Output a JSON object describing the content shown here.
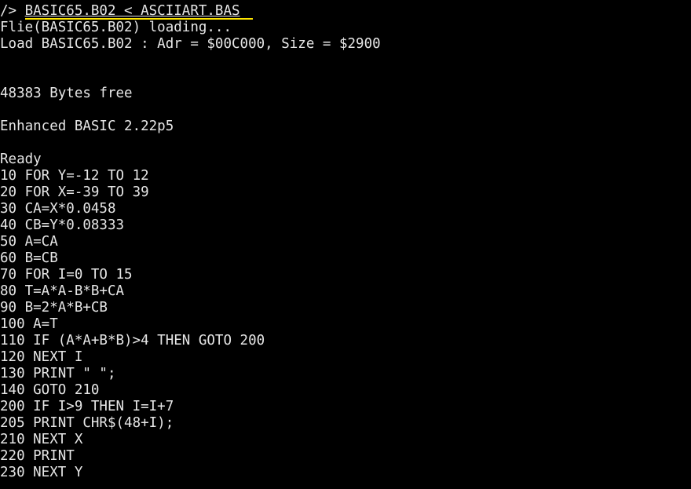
{
  "theme": {
    "background": "#000000",
    "foreground": "#e6e6e6",
    "highlight": "#ffe600"
  },
  "prompt": {
    "symbol": "/> ",
    "command": "BASIC65.B02 < ASCIIART.BAS"
  },
  "output": {
    "loading": "Flie(BASIC65.B02) loading...",
    "load_info": "Load BASIC65.B02 : Adr = $00C000, Size = $2900",
    "bytes_free": "48383 Bytes free",
    "version": "Enhanced BASIC 2.22p5",
    "ready": "Ready"
  },
  "program": [
    "10 FOR Y=-12 TO 12",
    "20 FOR X=-39 TO 39",
    "30 CA=X*0.0458",
    "40 CB=Y*0.08333",
    "50 A=CA",
    "60 B=CB",
    "70 FOR I=0 TO 15",
    "80 T=A*A-B*B+CA",
    "90 B=2*A*B+CB",
    "100 A=T",
    "110 IF (A*A+B*B)>4 THEN GOTO 200",
    "120 NEXT I",
    "130 PRINT \" \";",
    "140 GOTO 210",
    "200 IF I>9 THEN I=I+7",
    "205 PRINT CHR$(48+I);",
    "210 NEXT X",
    "220 PRINT",
    "230 NEXT Y"
  ]
}
